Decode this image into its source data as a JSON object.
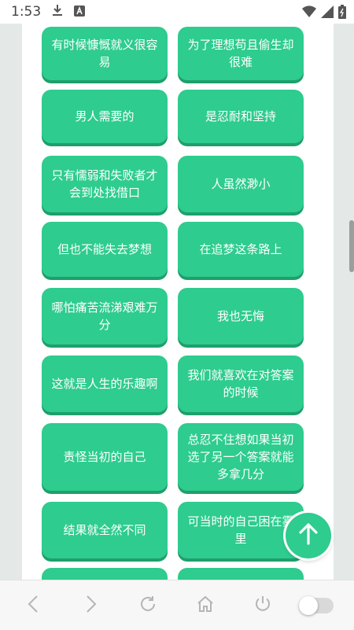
{
  "status_bar": {
    "time": "1:53",
    "icons": [
      "download-icon",
      "a-icon",
      "wifi-icon",
      "signal-icon",
      "battery-icon"
    ]
  },
  "cards": [
    "有时候慷慨就义很容易",
    "为了理想苟且偷生却很难",
    "男人需要的",
    "是忍耐和坚持",
    "只有懦弱和失败者才会到处找借口",
    "人虽然渺小",
    "但也不能失去梦想",
    "在追梦这条路上",
    "哪怕痛苦流涕艰难万分",
    "我也无悔",
    "这就是人生的乐趣啊",
    "我们就喜欢在对答案的时候",
    "责怪当初的自己",
    "总忍不住想如果当初选了另一个答案就能多拿几分",
    "结果就全然不同",
    "可当时的自己困在雾里"
  ],
  "fab": {
    "icon": "arrow-up-icon"
  },
  "bottom_bar": {
    "icons": [
      "back-icon",
      "forward-icon",
      "refresh-icon",
      "home-icon",
      "power-icon",
      "toggle-switch"
    ],
    "toggle_on": false
  },
  "colors": {
    "card": "#2ecc8e",
    "card_shadow": "#1f9f6c",
    "page_bg": "#e4e9e7"
  }
}
